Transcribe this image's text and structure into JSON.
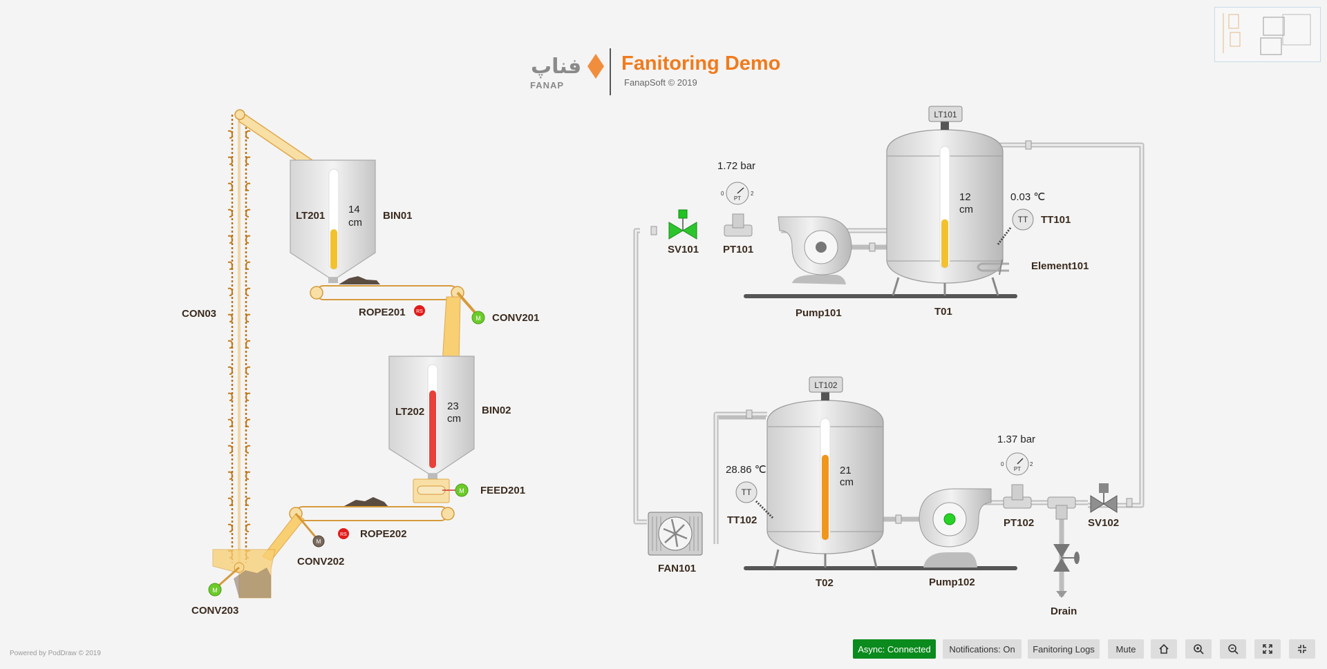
{
  "header": {
    "title": "Fanitoring Demo",
    "subtitle": "FanapSoft © 2019",
    "logo_text": "FANAP",
    "logo_script": "فناپ"
  },
  "footer": {
    "powered_by": "Powered by PodDraw © 2019"
  },
  "toolbar": {
    "async_label": "Async: Connected",
    "notifications_label": "Notifications: On",
    "logs_label": "Fanitoring Logs",
    "mute_label": "Mute",
    "home_icon": "home-icon",
    "zoom_in_icon": "zoom-in-icon",
    "zoom_out_icon": "zoom-out-icon",
    "fullscreen_icon": "fullscreen-icon",
    "fit_icon": "fit-icon",
    "async_color": "#0b8a1d"
  },
  "left_system": {
    "bin01": {
      "label": "BIN01",
      "sensor": "LT201",
      "value": "14",
      "unit": "cm",
      "level": 0.4,
      "color": "#f2c12e"
    },
    "bin02": {
      "label": "BIN02",
      "sensor": "LT202",
      "value": "23",
      "unit": "cm",
      "level": 0.75,
      "color": "#e8413a"
    },
    "con03": "CON03",
    "rope201": "ROPE201",
    "conv201": "CONV201",
    "feed201": "FEED201",
    "rope202": "ROPE202",
    "conv202": "CONV202",
    "conv203": "CONV203",
    "motor_label": "M",
    "rs_label": "RS"
  },
  "right_system": {
    "t01": {
      "label": "T01",
      "sensor": "LT101",
      "value": "12",
      "unit": "cm",
      "level": 0.4,
      "color": "#f2c12e"
    },
    "t02": {
      "label": "T02",
      "sensor": "LT102",
      "value": "21",
      "unit": "cm",
      "level": 0.7,
      "color": "#f0961a"
    },
    "pt101": {
      "label": "PT101",
      "reading": "1.72 bar"
    },
    "pt102": {
      "label": "PT102",
      "reading": "1.37 bar"
    },
    "tt101": {
      "label": "TT101",
      "reading": "0.03 ℃"
    },
    "tt102": {
      "label": "TT102",
      "reading": "28.86 ℃"
    },
    "sv101": "SV101",
    "sv102": "SV102",
    "pump101": "Pump101",
    "pump102": "Pump102",
    "element101": "Element101",
    "fan101": "FAN101",
    "drain": "Drain",
    "tt_symbol": "TT",
    "pt_symbol": "PT",
    "gauge_min": "0",
    "gauge_max": "2"
  }
}
